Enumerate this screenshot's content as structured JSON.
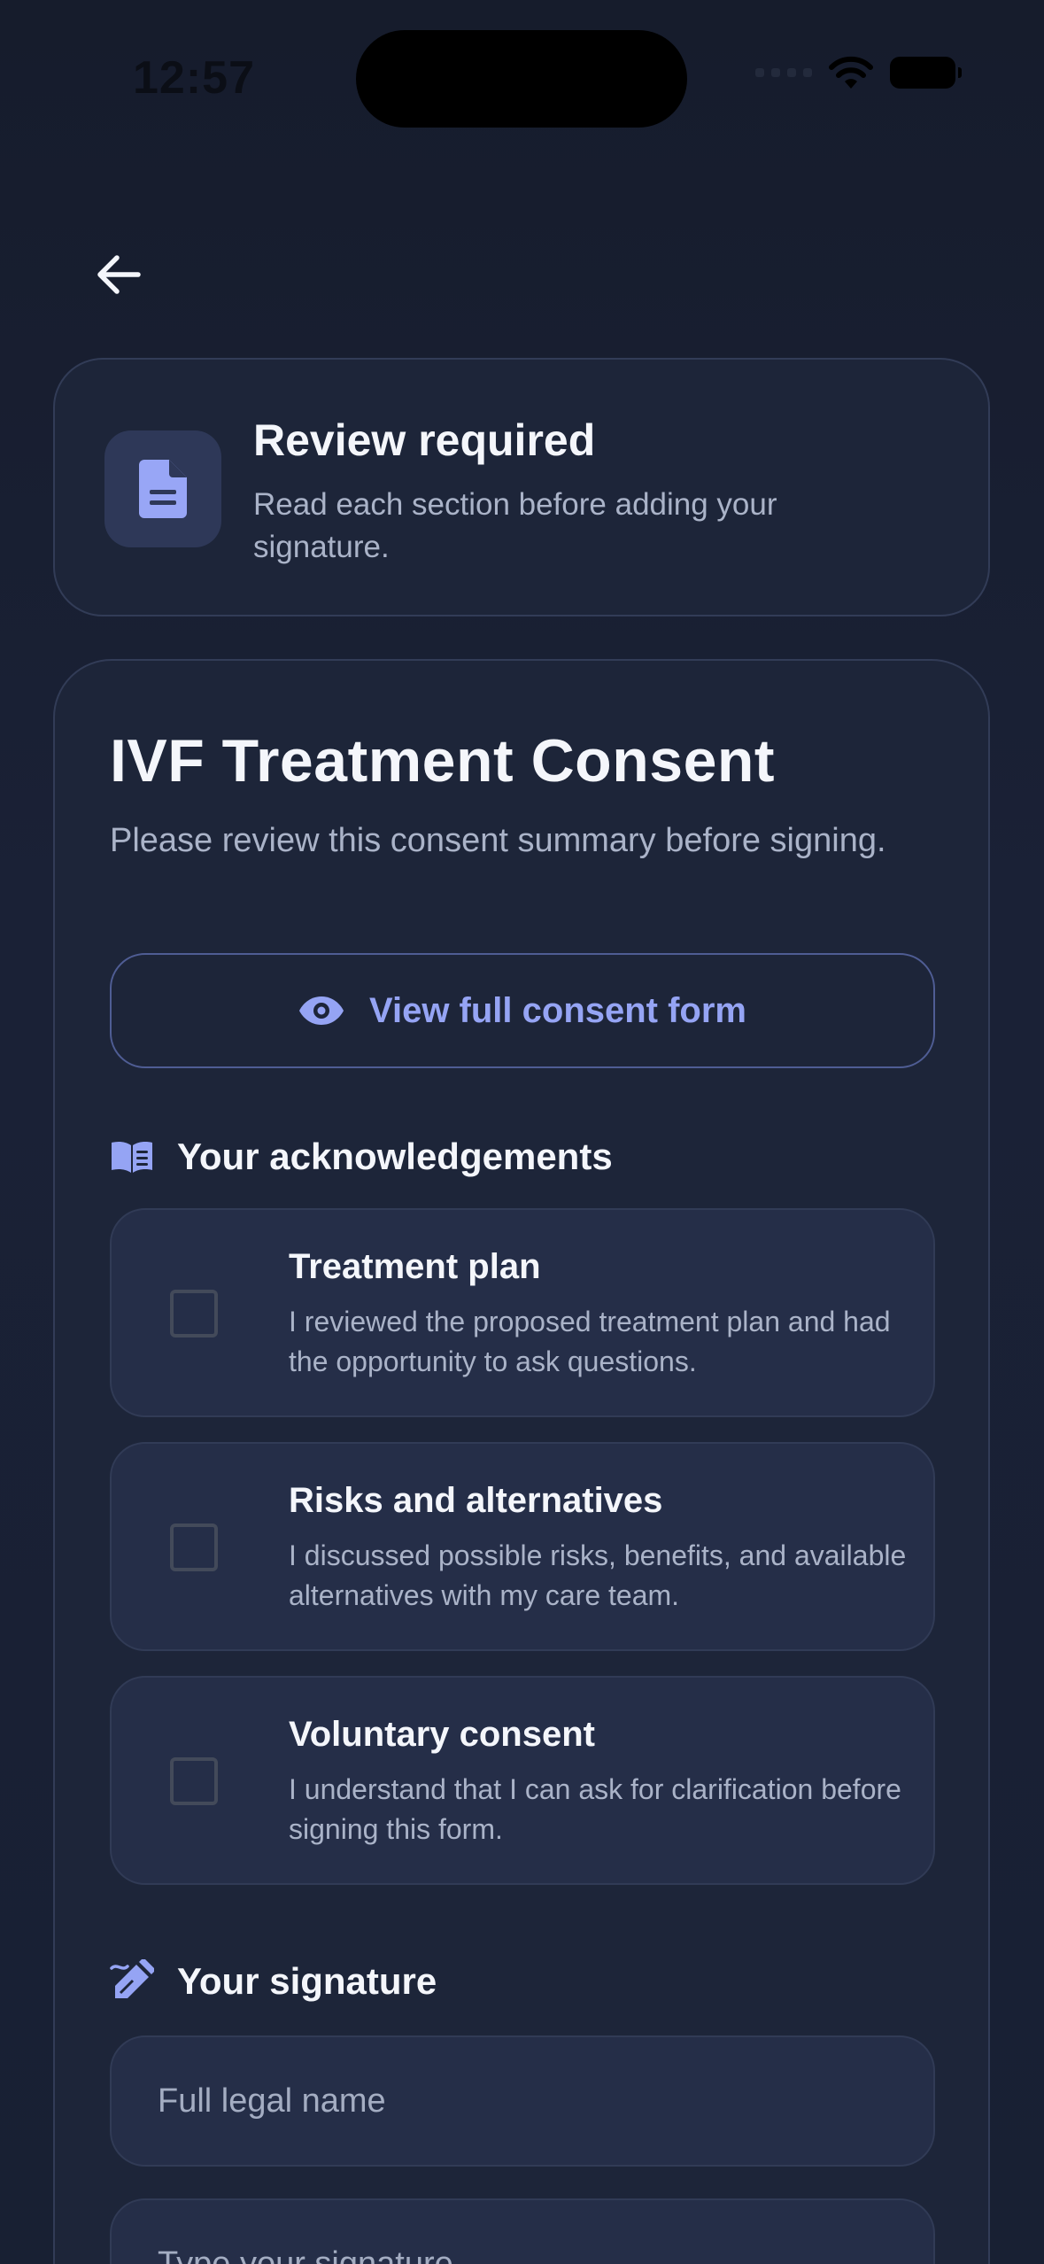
{
  "status_bar": {
    "time": "12:57"
  },
  "banner": {
    "title": "Review required",
    "text": "Read each section before adding your signature."
  },
  "consent": {
    "title": "IVF Treatment Consent",
    "subtitle": "Please review this consent summary before signing.",
    "view_button_label": "View full consent form"
  },
  "acknowledgements": {
    "heading": "Your acknowledgements",
    "items": [
      {
        "title": "Treatment plan",
        "text": "I reviewed the proposed treatment plan and had the opportunity to ask questions.",
        "checked": false
      },
      {
        "title": "Risks and alternatives",
        "text": "I discussed possible risks, benefits, and available alternatives with my care team.",
        "checked": false
      },
      {
        "title": "Voluntary consent",
        "text": "I understand that I can ask for clarification before signing this form.",
        "checked": false
      }
    ]
  },
  "signature": {
    "heading": "Your signature",
    "name_placeholder": "Full legal name",
    "signature_placeholder": "Type your signature"
  },
  "colors": {
    "background": "#161d2f",
    "card": "#1d2539",
    "accent": "#95a4f4",
    "muted_text": "#aab3c8"
  },
  "icons": {
    "back": "arrow-left-icon",
    "banner": "document-icon",
    "view": "eye-icon",
    "acknowledgements": "book-open-icon",
    "signature": "signature-pen-icon"
  }
}
